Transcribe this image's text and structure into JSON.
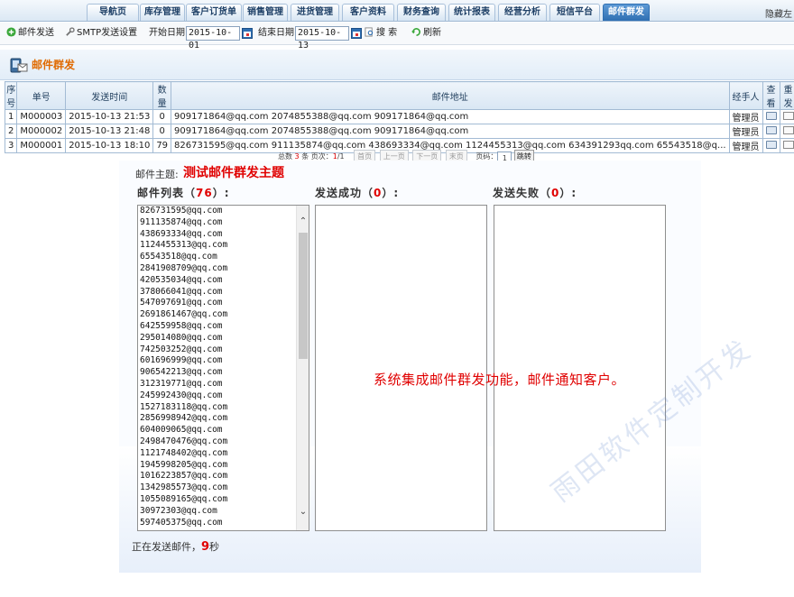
{
  "nav": {
    "tabs": [
      {
        "label": "导航页",
        "active": false
      },
      {
        "label": "库存管理",
        "active": false
      },
      {
        "label": "客户订货单",
        "active": false
      },
      {
        "label": "销售管理",
        "active": false
      },
      {
        "label": "进货管理",
        "active": false
      },
      {
        "label": "客户资料",
        "active": false
      },
      {
        "label": "财务查询",
        "active": false
      },
      {
        "label": "统计报表",
        "active": false
      },
      {
        "label": "经营分析",
        "active": false
      },
      {
        "label": "短信平台",
        "active": false
      },
      {
        "label": "邮件群发",
        "active": true
      }
    ],
    "right_text": "隐藏左"
  },
  "toolbar": {
    "send_label": "邮件发送",
    "smtp_label": "SMTP发送设置",
    "start_label": "开始日期:",
    "start_value": "2015-10-01",
    "end_label": "结束日期:",
    "end_value": "2015-10-13",
    "search_label": "搜 索",
    "refresh_label": "刷新"
  },
  "page": {
    "title": "邮件群发"
  },
  "table": {
    "headers": [
      "序号",
      "单号",
      "发送时间",
      "数量",
      "邮件地址",
      "经手人",
      "查看",
      "重发"
    ],
    "rows": [
      {
        "index": "1",
        "order": "M000003",
        "time": "2015-10-13 21:53",
        "count": "0",
        "emails": "909171864@qq.com 2074855388@qq.com 909171864@qq.com",
        "handler": "管理员"
      },
      {
        "index": "2",
        "order": "M000002",
        "time": "2015-10-13 21:48",
        "count": "0",
        "emails": "909171864@qq.com 2074855388@qq.com 909171864@qq.com",
        "handler": "管理员"
      },
      {
        "index": "3",
        "order": "M000001",
        "time": "2015-10-13 18:10",
        "count": "79",
        "emails": "826731595@qq.com 911135874@qq.com 438693334@qq.com 1124455313@qq.com 634391293qq.com 65543518@q...",
        "handler": "管理员"
      }
    ]
  },
  "pager": {
    "total_prefix": "总数",
    "total": "3",
    "total_suffix": "条 页次：",
    "page_current": "1",
    "page_sep": "/",
    "page_total": "1",
    "first": "首页",
    "prev": "上一页",
    "next": "下一页",
    "last": "末页",
    "page_label": "页码：",
    "page_input": "1",
    "go": "跳转"
  },
  "compose": {
    "subject_label": "邮件主题:",
    "subject_value": "测试邮件群发主题",
    "list_label_prefix": "邮件列表（",
    "list_count": "76",
    "list_label_suffix": "）:",
    "success_label_prefix": "发送成功（",
    "success_count": "0",
    "success_label_suffix": "）:",
    "fail_label_prefix": "发送失败（",
    "fail_count": "0",
    "fail_label_suffix": "）:",
    "emails": [
      "826731595@qq.com",
      "911135874@qq.com",
      "438693334@qq.com",
      "1124455313@qq.com",
      "65543518@qq.com",
      "2841908709@qq.com",
      "420535034@qq.com",
      "378066041@qq.com",
      "547097691@qq.com",
      "2691861467@qq.com",
      "642559958@qq.com",
      "295014080@qq.com",
      "742503252@qq.com",
      "601696999@qq.com",
      "906542213@qq.com",
      "312319771@qq.com",
      "245992430@qq.com",
      "1527183118@qq.com",
      "2856998942@qq.com",
      "604009065@qq.com",
      "2498470476@qq.com",
      "1121748402@qq.com",
      "1945998205@qq.com",
      "1016223857@qq.com",
      "1342985573@qq.com",
      "1055089165@qq.com",
      "30972303@qq.com",
      "597405375@qq.com"
    ],
    "system_message": "系统集成邮件群发功能，邮件通知客户。",
    "status_prefix": "正在发送邮件，",
    "status_seconds": "9",
    "status_suffix": "秒"
  },
  "watermark": "雨田软件定制开发",
  "colors": {
    "accent": "#2f6fb2",
    "title": "#e06a00",
    "highlight": "#e00000"
  }
}
